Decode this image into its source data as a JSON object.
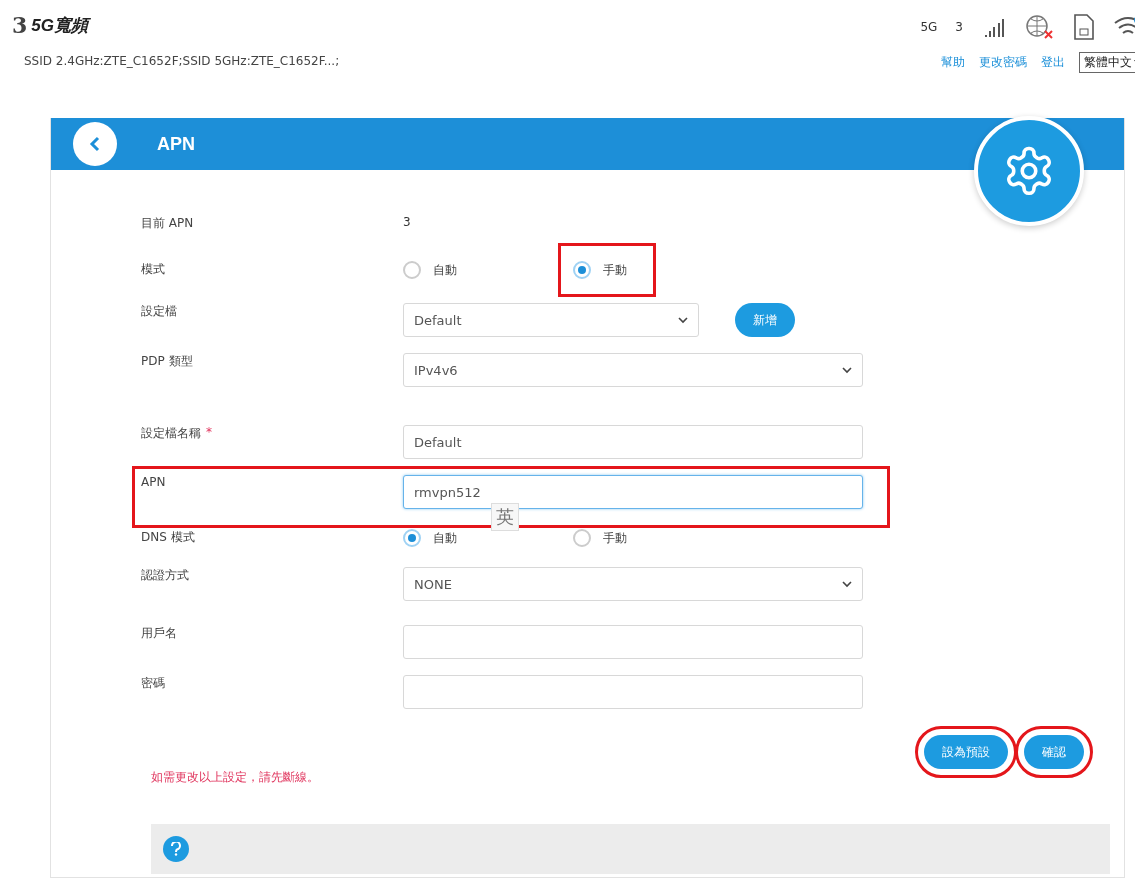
{
  "header": {
    "logo_mark": "3",
    "logo_text": "5G寬頻",
    "network": "5G",
    "signal_label": "3",
    "ssid": "SSID 2.4GHz:ZTE_C1652F;SSID 5GHz:ZTE_C1652F...;",
    "links": [
      "幫助",
      "更改密碼",
      "登出"
    ],
    "language": "繁體中文"
  },
  "panel": {
    "title": "APN",
    "rows": [
      {
        "kind": "text",
        "label": "目前 APN",
        "value": "3",
        "highlighted": false
      },
      {
        "kind": "radio",
        "label": "模式",
        "highlighted": false,
        "options": [
          {
            "label": "自動",
            "selected": false,
            "highlighted": false
          },
          {
            "label": "手動",
            "selected": true,
            "highlighted": true
          }
        ]
      },
      {
        "kind": "select",
        "label": "設定檔",
        "value": "Default",
        "button": "新增",
        "highlighted": false
      },
      {
        "kind": "select",
        "label": "PDP 類型",
        "value": "IPv4v6",
        "highlighted": false
      },
      {
        "kind": "input",
        "label": "設定檔名稱",
        "required_mark": "*",
        "value": "Default",
        "focused": false,
        "highlighted": false
      },
      {
        "kind": "input",
        "label": "APN",
        "value": "rmvpn512",
        "focused": true,
        "ime": "英",
        "highlighted": true
      },
      {
        "kind": "radio",
        "label": "DNS 模式",
        "highlighted": false,
        "options": [
          {
            "label": "自動",
            "selected": true,
            "highlighted": false
          },
          {
            "label": "手動",
            "selected": false,
            "highlighted": false
          }
        ]
      },
      {
        "kind": "select",
        "label": "認證方式",
        "value": "NONE",
        "highlighted": false
      },
      {
        "kind": "input",
        "label": "用戶名",
        "value": "",
        "focused": false,
        "highlighted": false
      },
      {
        "kind": "input",
        "label": "密碼",
        "value": "",
        "focused": false,
        "highlighted": false
      }
    ],
    "buttons": [
      {
        "label": "設為預設",
        "highlighted": true
      },
      {
        "label": "確認",
        "highlighted": true
      }
    ],
    "note": "如需更改以上設定，請先斷線。"
  }
}
